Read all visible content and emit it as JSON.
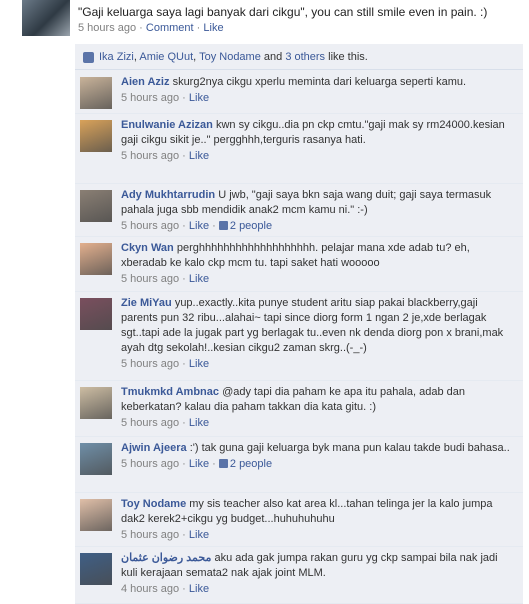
{
  "post": {
    "text": "\"Gaji keluarga saya lagi banyak dari cikgu\", you can still smile even in pain. :)",
    "time": "5 hours ago",
    "sep": "·",
    "comment_label": "Comment",
    "like_label": "Like"
  },
  "likes": {
    "names": [
      "Ika Zizi",
      "Amie QUut",
      "Toy Nodame"
    ],
    "sep1": ", ",
    "sep2": ", ",
    "and": " and ",
    "others": "3 others",
    "suffix": " like this."
  },
  "comments": [
    {
      "author": "Aien Aziz",
      "text": "skurg2nya cikgu xperlu meminta dari keluarga seperti kamu.",
      "time": "5 hours ago",
      "sep": "·",
      "like": "Like",
      "people": "",
      "avatar_color": "#c9b39a"
    },
    {
      "author": "Enulwanie Azizan",
      "text": "kwn sy cikgu..dia pn ckp cmtu.\"gaji mak sy rm24000.kesian gaji cikgu sikit je..\" pergghhh,terguris rasanya hati.",
      "time": "5 hours ago",
      "sep": "·",
      "like": "Like",
      "people": "",
      "avatar_color": "#d9a25a"
    },
    {
      "author": "Ady Mukhtarrudin",
      "text": "U jwb, \"gaji saya bkn saja wang duit; gaji saya termasuk pahala juga sbb mendidik anak2 mcm kamu ni.\" :-)",
      "time": "5 hours ago",
      "sep": "·",
      "like": "Like",
      "people": "2 people",
      "avatar_color": "#8a7f74"
    },
    {
      "author": "Ckyn Wan",
      "text": "perghhhhhhhhhhhhhhhhhhh. pelajar mana xde adab tu? eh, xberadab ke kalo ckp mcm tu. tapi saket hati wooooo",
      "time": "5 hours ago",
      "sep": "·",
      "like": "Like",
      "people": "",
      "avatar_color": "#e3b08e"
    },
    {
      "author": "Zie MiYau",
      "text": "yup..exactly..kita punye student aritu siap pakai blackberry,gaji parents pun 32 ribu...alahai~ tapi since diorg form 1 ngan 2 je,xde berlagak sgt..tapi ade la jugak part yg berlagak tu..even nk denda diorg pon x brani,mak ayah dtg sekolah!..kesian cikgu2 zaman skrg..(-_-)",
      "time": "5 hours ago",
      "sep": "·",
      "like": "Like",
      "people": "",
      "avatar_color": "#7a4f5e"
    },
    {
      "author": "Tmukmkd Ambnac",
      "text": "@ady tapi dia paham ke apa itu pahala, adab dan keberkatan? kalau dia paham takkan dia kata gitu. :)",
      "time": "5 hours ago",
      "sep": "·",
      "like": "Like",
      "people": "",
      "avatar_color": "#cdbda3"
    },
    {
      "author": "Ajwin Ajeera",
      "text": ":') tak guna gaji keluarga byk mana pun kalau takde budi bahasa..",
      "time": "5 hours ago",
      "sep": "·",
      "like": "Like",
      "people": "2 people",
      "avatar_color": "#6f8fa8"
    },
    {
      "author": "Toy Nodame",
      "text": "my sis teacher also kat area kl...tahan telinga jer la kalo jumpa dak2 kerek2+cikgu yg budget...huhuhuhuhu",
      "time": "5 hours ago",
      "sep": "·",
      "like": "Like",
      "people": "",
      "avatar_color": "#e0bfa8"
    },
    {
      "author": "محمد رضوان عثمان",
      "text": "aku ada gak jumpa rakan guru yg ckp sampai bila nak jadi kuli kerajaan semata2 nak ajak joint MLM.",
      "time": "4 hours ago",
      "sep": "·",
      "like": "Like",
      "people": "",
      "avatar_color": "#3f5f86"
    }
  ]
}
